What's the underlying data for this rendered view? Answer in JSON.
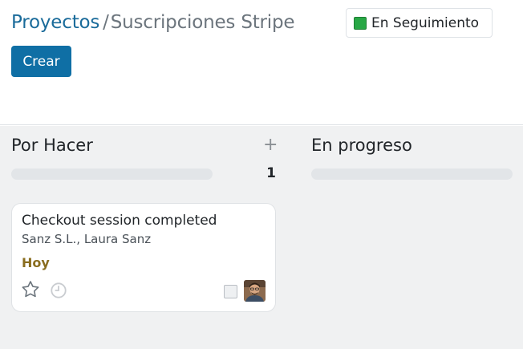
{
  "header": {
    "breadcrumb_parent": "Proyectos",
    "breadcrumb_separator": "/",
    "breadcrumb_current": "Suscripciones Stripe",
    "status_label": "En Seguimiento",
    "status_color": "#28a745",
    "create_label": "Crear"
  },
  "columns": [
    {
      "title": "Por Hacer",
      "add_icon": "+",
      "count": "1",
      "cards": [
        {
          "title": "Checkout session completed",
          "subtitle": "Sanz S.L., Laura Sanz",
          "deadline": "Hoy",
          "deadline_color": "#8a6d1f",
          "icons": [
            "star-icon",
            "clock-icon",
            "checkbox-icon",
            "avatar"
          ]
        }
      ]
    },
    {
      "title": "En progreso",
      "count": "",
      "cards": []
    }
  ],
  "colors": {
    "accent": "#0f6fa5",
    "link": "#1a6b9a",
    "board_bg": "#f0f1f2"
  }
}
